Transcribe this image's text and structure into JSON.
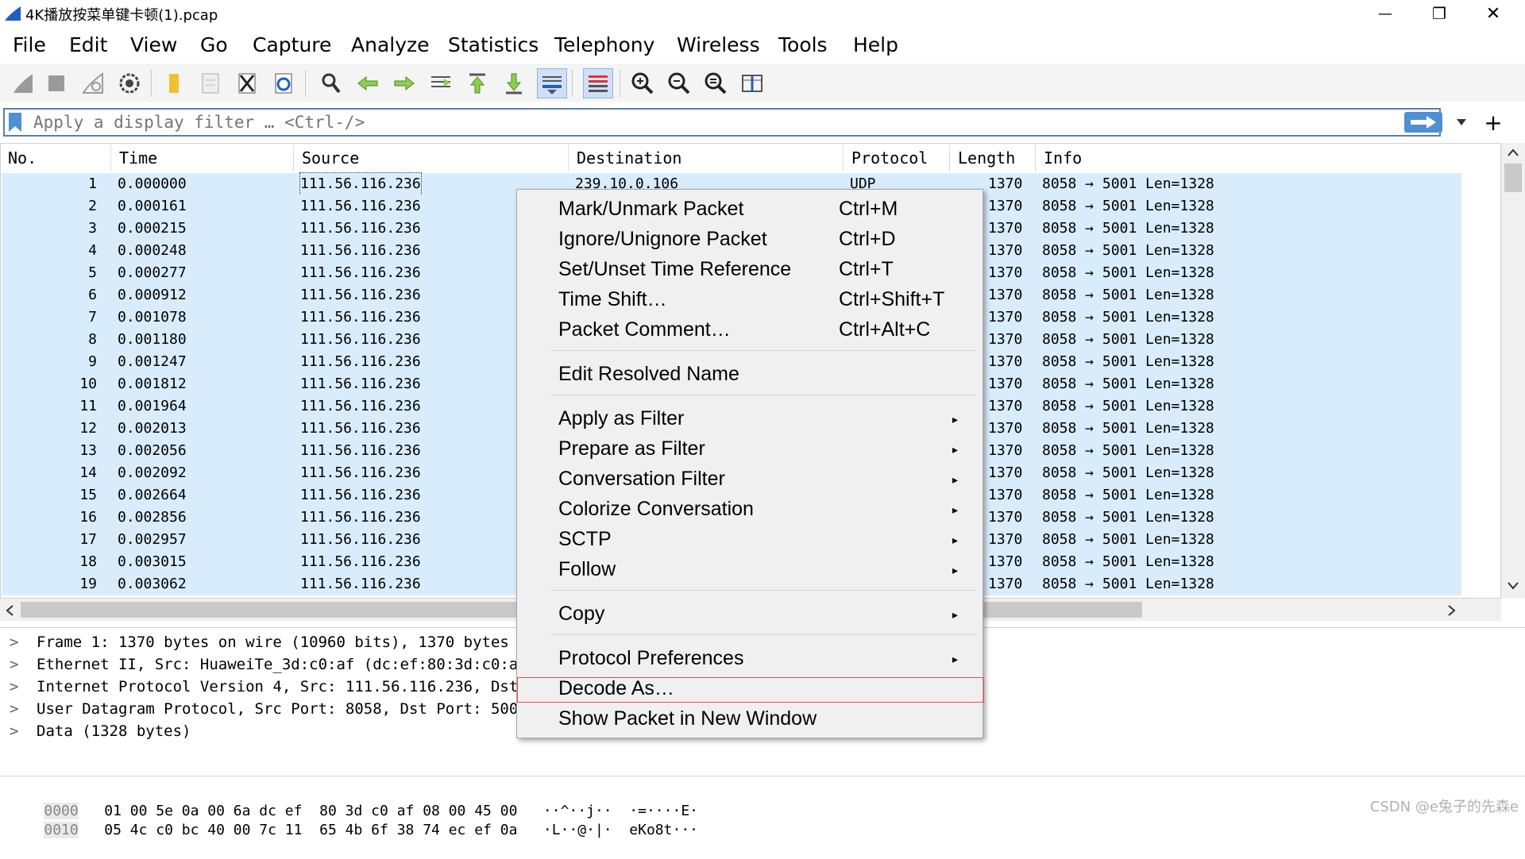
{
  "window": {
    "title": "4K播放按菜单键卡顿(1).pcap",
    "minimize_glyph": "—",
    "restore_glyph": "❐",
    "close_glyph": "✕"
  },
  "menubar": {
    "items": [
      "File",
      "Edit",
      "View",
      "Go",
      "Capture",
      "Analyze",
      "Statistics",
      "Telephony",
      "Wireless",
      "Tools",
      "Help"
    ]
  },
  "toolbar": {
    "icons": [
      "shark-fin-start-icon",
      "stop-icon",
      "restart-icon",
      "options-gear-icon",
      "open-folder-icon",
      "save-file-icon",
      "close-file-icon",
      "reload-icon",
      "find-icon",
      "go-back-icon",
      "go-forward-icon",
      "go-to-packet-icon",
      "first-packet-icon",
      "last-packet-icon",
      "autoscroll-icon",
      "colorize-icon",
      "zoom-in-icon",
      "zoom-out-icon",
      "normal-size-icon",
      "resize-columns-icon"
    ]
  },
  "filter": {
    "placeholder": "Apply a display filter … <Ctrl-/>",
    "add_label": "+"
  },
  "packet_list": {
    "columns": [
      "No.",
      "Time",
      "Source",
      "Destination",
      "Protocol",
      "Length",
      "Info"
    ],
    "rows": [
      {
        "no": "1",
        "time": "0.000000",
        "source": "111.56.116.236",
        "destination": "239.10.0.106",
        "protocol": "UDP",
        "length": "1370",
        "info": "8058 → 5001 Len=1328"
      },
      {
        "no": "2",
        "time": "0.000161",
        "source": "111.56.116.236",
        "destination": "",
        "protocol": "",
        "length": "1370",
        "info": "8058 → 5001 Len=1328"
      },
      {
        "no": "3",
        "time": "0.000215",
        "source": "111.56.116.236",
        "destination": "",
        "protocol": "",
        "length": "1370",
        "info": "8058 → 5001 Len=1328"
      },
      {
        "no": "4",
        "time": "0.000248",
        "source": "111.56.116.236",
        "destination": "",
        "protocol": "",
        "length": "1370",
        "info": "8058 → 5001 Len=1328"
      },
      {
        "no": "5",
        "time": "0.000277",
        "source": "111.56.116.236",
        "destination": "",
        "protocol": "",
        "length": "1370",
        "info": "8058 → 5001 Len=1328"
      },
      {
        "no": "6",
        "time": "0.000912",
        "source": "111.56.116.236",
        "destination": "",
        "protocol": "",
        "length": "1370",
        "info": "8058 → 5001 Len=1328"
      },
      {
        "no": "7",
        "time": "0.001078",
        "source": "111.56.116.236",
        "destination": "",
        "protocol": "",
        "length": "1370",
        "info": "8058 → 5001 Len=1328"
      },
      {
        "no": "8",
        "time": "0.001180",
        "source": "111.56.116.236",
        "destination": "",
        "protocol": "",
        "length": "1370",
        "info": "8058 → 5001 Len=1328"
      },
      {
        "no": "9",
        "time": "0.001247",
        "source": "111.56.116.236",
        "destination": "",
        "protocol": "",
        "length": "1370",
        "info": "8058 → 5001 Len=1328"
      },
      {
        "no": "10",
        "time": "0.001812",
        "source": "111.56.116.236",
        "destination": "",
        "protocol": "",
        "length": "1370",
        "info": "8058 → 5001 Len=1328"
      },
      {
        "no": "11",
        "time": "0.001964",
        "source": "111.56.116.236",
        "destination": "",
        "protocol": "",
        "length": "1370",
        "info": "8058 → 5001 Len=1328"
      },
      {
        "no": "12",
        "time": "0.002013",
        "source": "111.56.116.236",
        "destination": "",
        "protocol": "",
        "length": "1370",
        "info": "8058 → 5001 Len=1328"
      },
      {
        "no": "13",
        "time": "0.002056",
        "source": "111.56.116.236",
        "destination": "",
        "protocol": "",
        "length": "1370",
        "info": "8058 → 5001 Len=1328"
      },
      {
        "no": "14",
        "time": "0.002092",
        "source": "111.56.116.236",
        "destination": "",
        "protocol": "",
        "length": "1370",
        "info": "8058 → 5001 Len=1328"
      },
      {
        "no": "15",
        "time": "0.002664",
        "source": "111.56.116.236",
        "destination": "",
        "protocol": "",
        "length": "1370",
        "info": "8058 → 5001 Len=1328"
      },
      {
        "no": "16",
        "time": "0.002856",
        "source": "111.56.116.236",
        "destination": "",
        "protocol": "",
        "length": "1370",
        "info": "8058 → 5001 Len=1328"
      },
      {
        "no": "17",
        "time": "0.002957",
        "source": "111.56.116.236",
        "destination": "",
        "protocol": "",
        "length": "1370",
        "info": "8058 → 5001 Len=1328"
      },
      {
        "no": "18",
        "time": "0.003015",
        "source": "111.56.116.236",
        "destination": "",
        "protocol": "",
        "length": "1370",
        "info": "8058 → 5001 Len=1328"
      },
      {
        "no": "19",
        "time": "0.003062",
        "source": "111.56.116.236",
        "destination": "",
        "protocol": "",
        "length": "1370",
        "info": "8058 → 5001 Len=1328"
      }
    ],
    "row_color": "#d9ecfc"
  },
  "details": {
    "rows": [
      "Frame 1: 1370 bytes on wire (10960 bits), 1370 bytes ca",
      "Ethernet II, Src: HuaweiTe_3d:c0:af (dc:ef:80:3d:c0:af)",
      "Internet Protocol Version 4, Src: 111.56.116.236, Dst:",
      "User Datagram Protocol, Src Port: 8058, Dst Port: 5001",
      "Data (1328 bytes)"
    ]
  },
  "bytes": {
    "rows": [
      {
        "offset": "0000",
        "hex": "01 00 5e 0a 00 6a dc ef  80 3d c0 af 08 00 45 00",
        "ascii": "··^··j··  ·=····E·"
      },
      {
        "offset": "0010",
        "hex": "05 4c c0 bc 40 00 7c 11  65 4b 6f 38 74 ec ef 0a",
        "ascii": "·L··@·|·  eKo8t···"
      }
    ]
  },
  "context_menu": {
    "items": [
      {
        "label": "Mark/Unmark Packet",
        "shortcut": "Ctrl+M",
        "submenu": false
      },
      {
        "label": "Ignore/Unignore Packet",
        "shortcut": "Ctrl+D",
        "submenu": false
      },
      {
        "label": "Set/Unset Time Reference",
        "shortcut": "Ctrl+T",
        "submenu": false
      },
      {
        "label": "Time Shift…",
        "shortcut": "Ctrl+Shift+T",
        "submenu": false
      },
      {
        "label": "Packet Comment…",
        "shortcut": "Ctrl+Alt+C",
        "submenu": false
      },
      {
        "label": "Edit Resolved Name",
        "shortcut": "",
        "submenu": false
      },
      {
        "label": "Apply as Filter",
        "shortcut": "",
        "submenu": true
      },
      {
        "label": "Prepare as Filter",
        "shortcut": "",
        "submenu": true
      },
      {
        "label": "Conversation Filter",
        "shortcut": "",
        "submenu": true
      },
      {
        "label": "Colorize Conversation",
        "shortcut": "",
        "submenu": true
      },
      {
        "label": "SCTP",
        "shortcut": "",
        "submenu": true
      },
      {
        "label": "Follow",
        "shortcut": "",
        "submenu": true
      },
      {
        "label": "Copy",
        "shortcut": "",
        "submenu": true
      },
      {
        "label": "Protocol Preferences",
        "shortcut": "",
        "submenu": true
      },
      {
        "label": "Decode As…",
        "shortcut": "",
        "submenu": false
      },
      {
        "label": "Show Packet in New Window",
        "shortcut": "",
        "submenu": false
      }
    ],
    "highlighted": "Decode As…",
    "highlight_color": "#e05050",
    "submenu_glyph": "▸"
  },
  "watermark": "CSDN @e兔子的先森e"
}
